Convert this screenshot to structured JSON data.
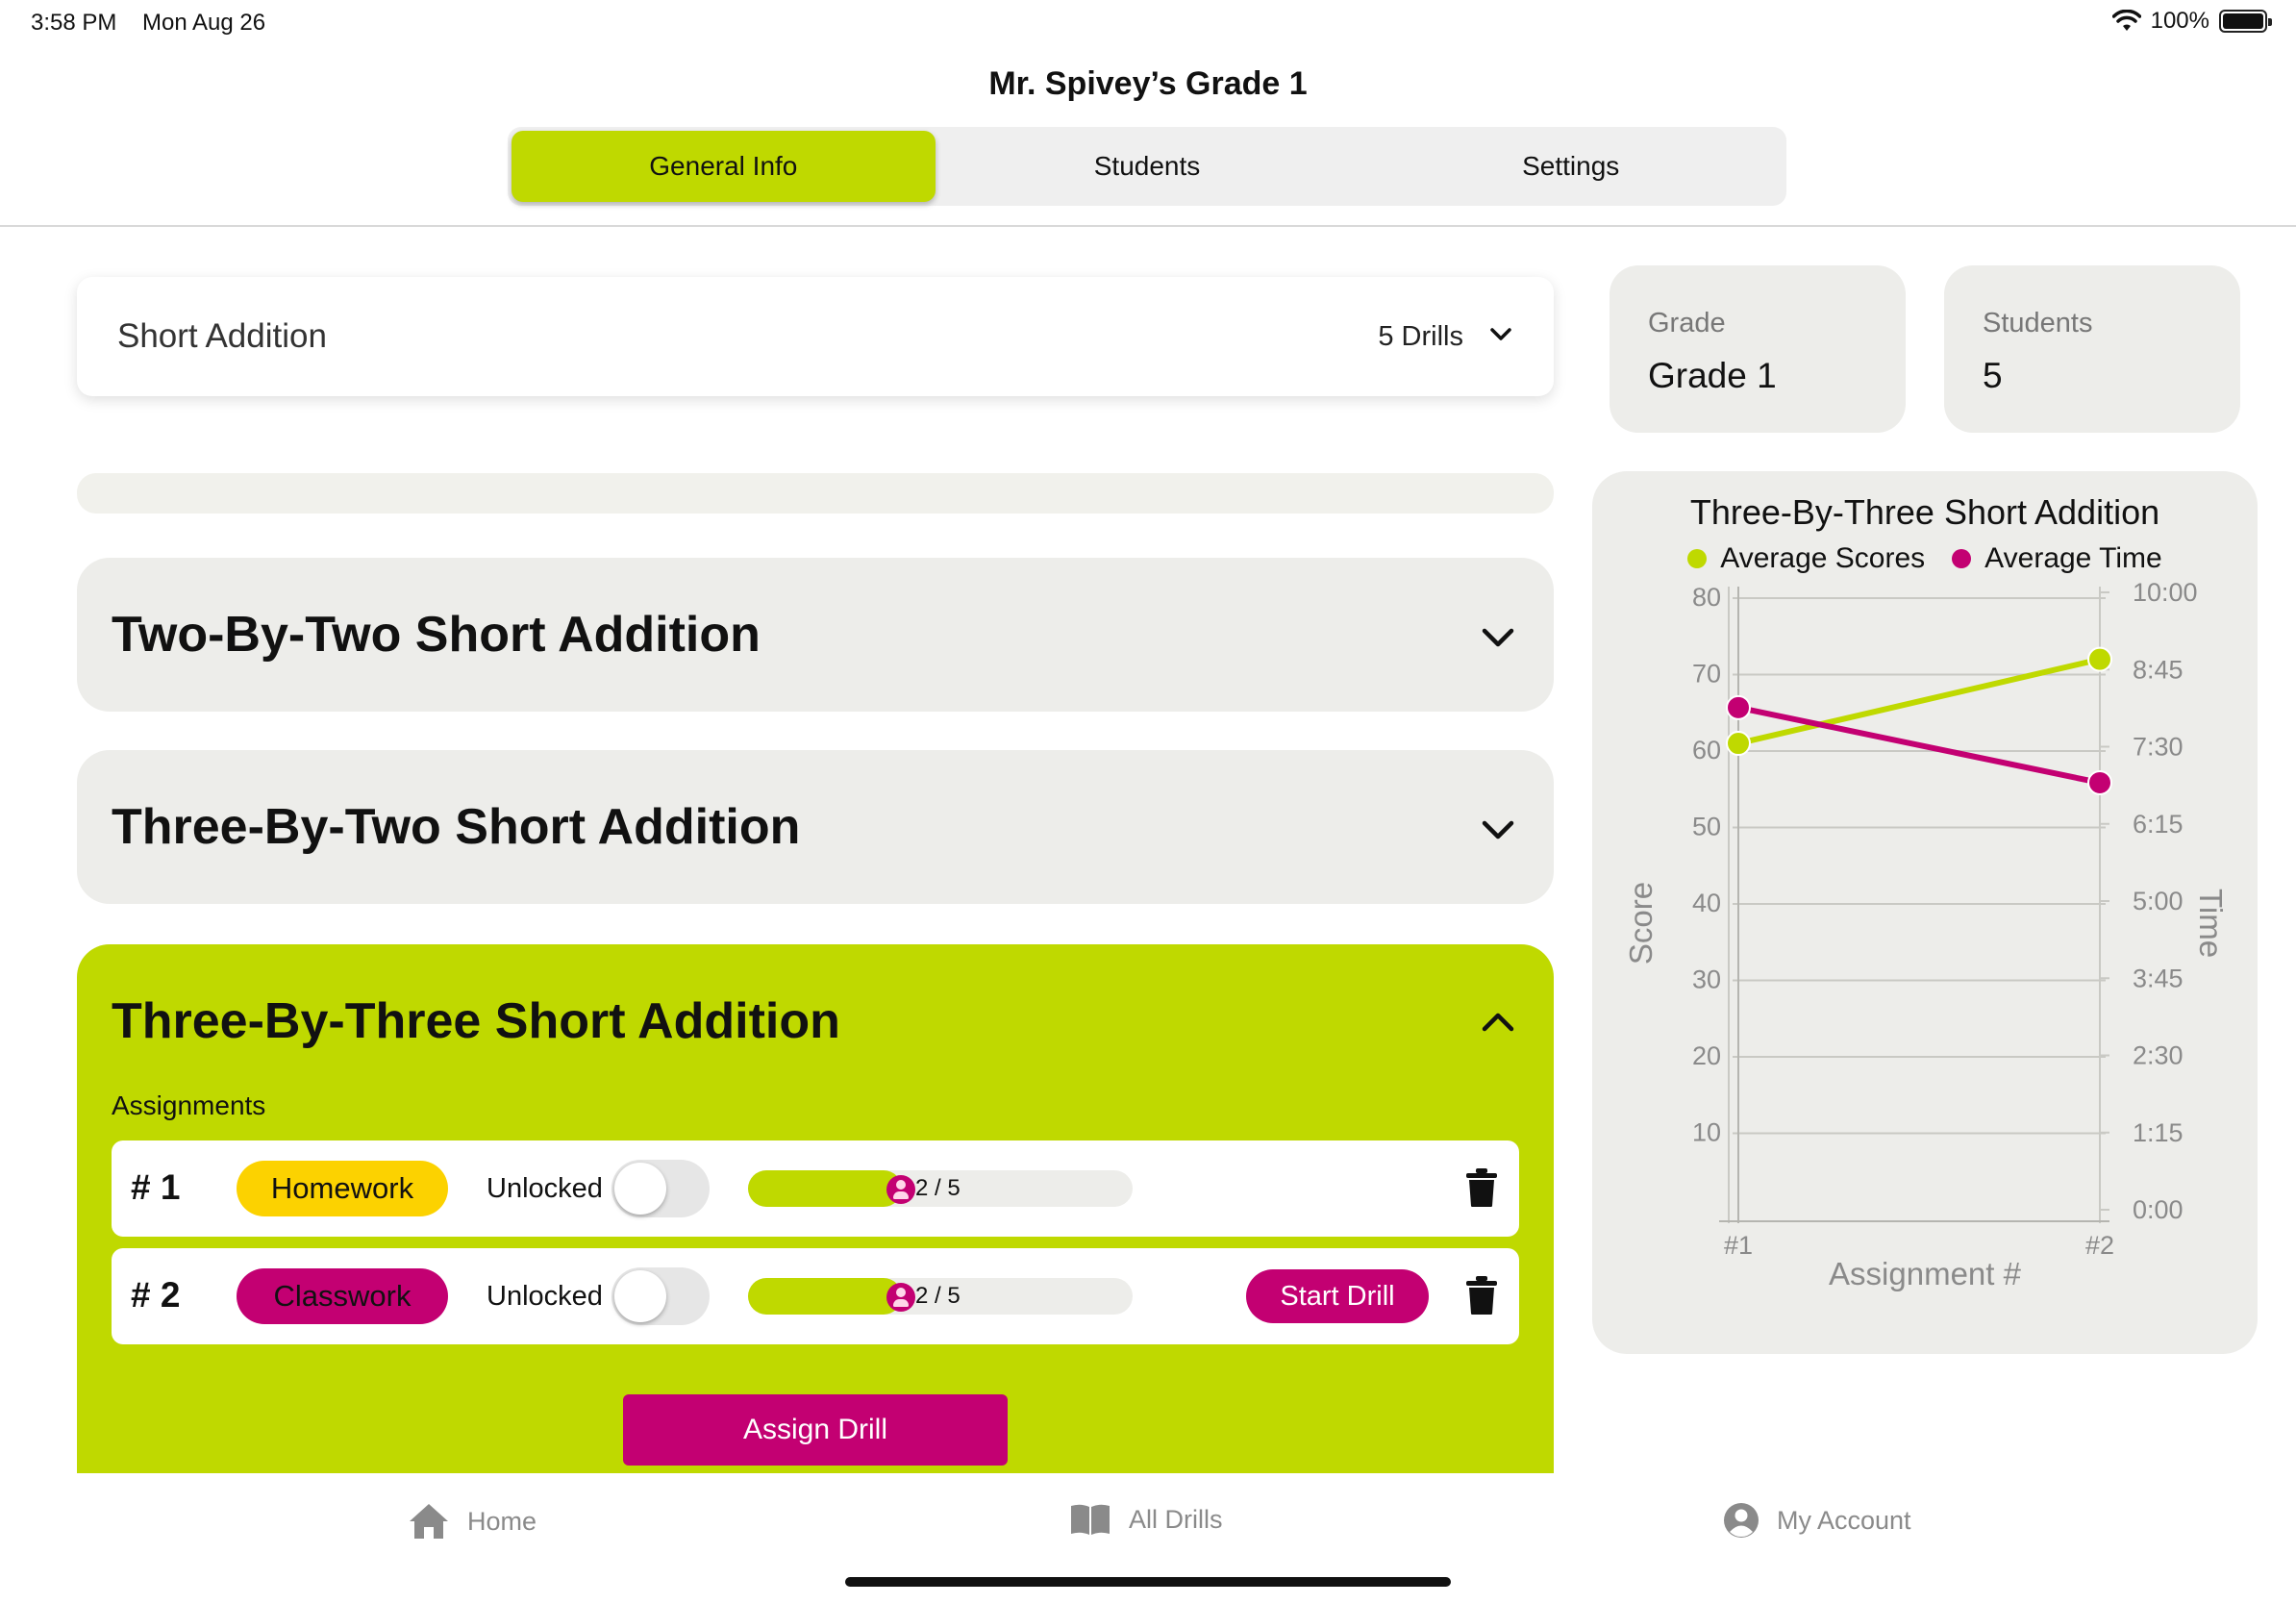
{
  "status_bar": {
    "time": "3:58 PM",
    "date": "Mon Aug 26",
    "battery": "100%"
  },
  "header": {
    "title": "Mr. Spivey’s Grade 1",
    "tabs": [
      {
        "label": "General Info",
        "active": true
      },
      {
        "label": "Students",
        "active": false
      },
      {
        "label": "Settings",
        "active": false
      }
    ]
  },
  "collection": {
    "title": "Short Addition",
    "count": "5 Drills"
  },
  "drills": [
    {
      "title": "Two-By-Two Short Addition",
      "expanded": false
    },
    {
      "title": "Three-By-Two Short Addition",
      "expanded": false
    },
    {
      "title": "Three-By-Three Short Addition",
      "expanded": true
    }
  ],
  "assignments_label": "Assignments",
  "assignments": [
    {
      "number": "# 1",
      "type": "Homework",
      "lock_status": "Unlocked",
      "unlocked_toggle_on": false,
      "progress_text": "2 / 5",
      "progress_fraction": 0.4,
      "start_button": null
    },
    {
      "number": "# 2",
      "type": "Classwork",
      "lock_status": "Unlocked",
      "unlocked_toggle_on": false,
      "progress_text": "2 / 5",
      "progress_fraction": 0.4,
      "start_button": "Start Drill"
    }
  ],
  "assign_drill_label": "Assign Drill",
  "stats": [
    {
      "label": "Grade",
      "value": "Grade 1"
    },
    {
      "label": "Students",
      "value": "5"
    }
  ],
  "colors": {
    "accent_green": "#bfd900",
    "accent_magenta": "#c30072",
    "homework_yellow": "#fcd200",
    "card_gray": "#ededea"
  },
  "chart_data": {
    "type": "line",
    "title": "Three-By-Three Short Addition",
    "categories": [
      "#1",
      "#2"
    ],
    "xlabel": "Assignment #",
    "ylabel": "Score",
    "y2label": "Time",
    "ylim": [
      0,
      80
    ],
    "yticks": [
      "10",
      "20",
      "30",
      "40",
      "50",
      "60",
      "70",
      "80"
    ],
    "y2ticks": [
      "0:00",
      "1:15",
      "2:30",
      "3:45",
      "5:00",
      "6:15",
      "7:30",
      "8:45",
      "10:00"
    ],
    "y2lim_seconds": [
      0,
      600
    ],
    "grid": true,
    "legend_position": "top",
    "series": [
      {
        "name": "Average Scores",
        "axis": "left",
        "color": "#bfd900",
        "values": [
          61,
          72
        ]
      },
      {
        "name": "Average Time",
        "axis": "right",
        "color": "#c30072",
        "values_seconds": [
          488,
          415
        ]
      }
    ]
  },
  "tabbar": {
    "items": [
      {
        "label": "Home",
        "icon": "home-icon"
      },
      {
        "label": "All Drills",
        "icon": "book-icon"
      },
      {
        "label": "My Account",
        "icon": "account-icon"
      }
    ]
  }
}
